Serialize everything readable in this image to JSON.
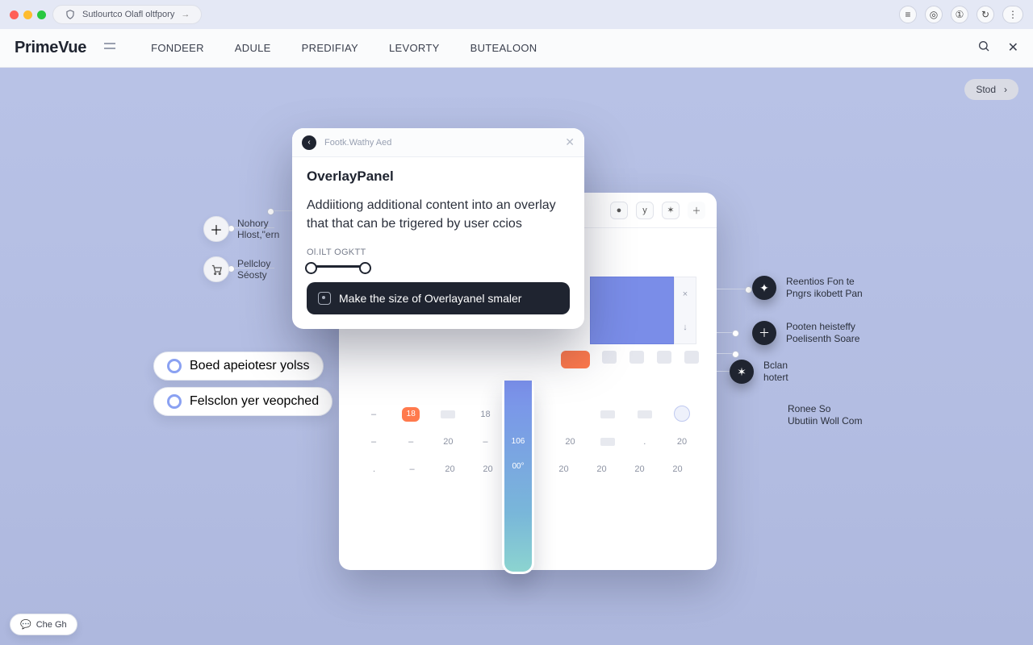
{
  "browser": {
    "url_label": "Sutlourtco Olafl oltfpory"
  },
  "header": {
    "logo": "PrimeVue",
    "nav": [
      "FONDEER",
      "ADULE",
      "PREDIFIAY",
      "LEVORTY",
      "BUTEALOON"
    ]
  },
  "top_pill": "Stod",
  "overlay": {
    "chip": "Footk.Wathy Aed",
    "title": "OverlayPanel",
    "desc": "Addiitiong additional content into an overlay that that can be trigered by user ccios",
    "small": "Ol.ILT OGKTT",
    "cta": "Make the size of Overlayanel smaler"
  },
  "left_features": {
    "f1_l1": "Nohory",
    "f1_l2": "Hlost,\"ern",
    "f2_l1": "Pellcloy",
    "f2_l2": "Séosty",
    "p1": "Boed apeiotesr yolss",
    "p2": "Felsclon yer veopched"
  },
  "right_callouts": {
    "c1_l1": "Reentios Fon te",
    "c1_l2": "Pngrs ikobett Pan",
    "c2_l1": "Pooten heisteffy",
    "c2_l2": "Poelisenth Soare",
    "c3_l1": "Bclan",
    "c3_l2": "hotert",
    "c4_l1": "Ronee So",
    "c4_l2": "Ubutiin Woll Com"
  },
  "calendar": {
    "chip18": "18",
    "row1": [
      "18",
      "20",
      "",
      "",
      "",
      "",
      "",
      "20"
    ],
    "row2": [
      "",
      "20",
      "20",
      "20",
      "",
      "20",
      "20",
      "20",
      "20"
    ],
    "thermo_a": "106",
    "thermo_b": "00°"
  },
  "chat": "Che Gh"
}
